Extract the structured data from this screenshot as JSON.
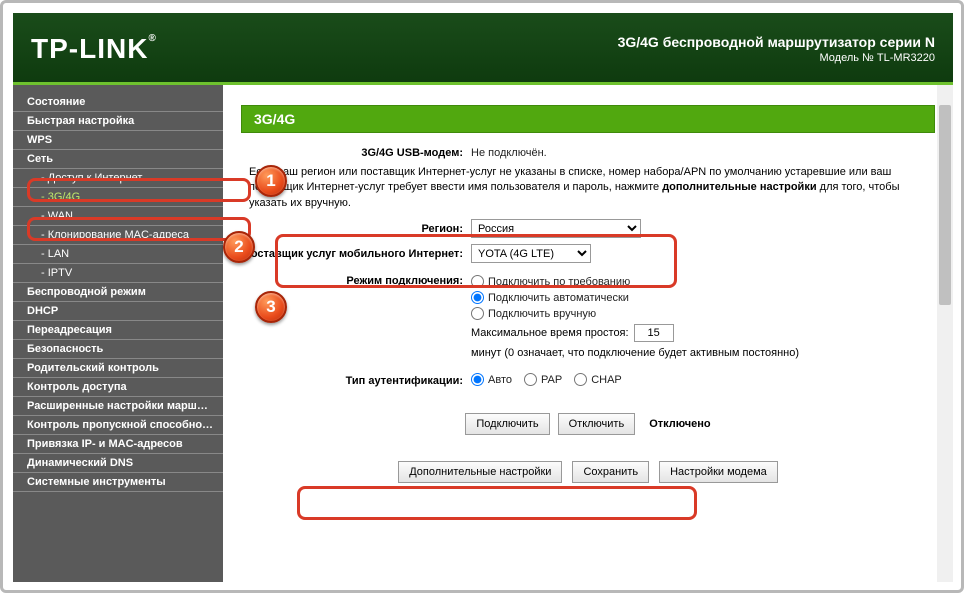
{
  "header": {
    "brand": "TP-LINK",
    "title": "3G/4G беспроводной маршрутизатор серии N",
    "model": "Модель № TL-MR3220"
  },
  "sidebar": {
    "items": [
      {
        "label": "Состояние",
        "sub": false
      },
      {
        "label": "Быстрая настройка",
        "sub": false
      },
      {
        "label": "WPS",
        "sub": false
      },
      {
        "label": "Сеть",
        "sub": false
      },
      {
        "label": "- Доступ к Интернет",
        "sub": true
      },
      {
        "label": "- 3G/4G",
        "sub": true,
        "active": true
      },
      {
        "label": "- WAN",
        "sub": true
      },
      {
        "label": "- Клонирование MAC-адреса",
        "sub": true
      },
      {
        "label": "- LAN",
        "sub": true
      },
      {
        "label": "- IPTV",
        "sub": true
      },
      {
        "label": "Беспроводной режим",
        "sub": false
      },
      {
        "label": "DHCP",
        "sub": false
      },
      {
        "label": "Переадресация",
        "sub": false
      },
      {
        "label": "Безопасность",
        "sub": false
      },
      {
        "label": "Родительский контроль",
        "sub": false
      },
      {
        "label": "Контроль доступа",
        "sub": false
      },
      {
        "label": "Расширенные настройки маршрутизации",
        "sub": false
      },
      {
        "label": "Контроль пропускной способности",
        "sub": false
      },
      {
        "label": "Привязка IP- и MAC-адресов",
        "sub": false
      },
      {
        "label": "Динамический DNS",
        "sub": false
      },
      {
        "label": "Системные инструменты",
        "sub": false
      }
    ]
  },
  "main": {
    "section_title": "3G/4G",
    "modem": {
      "label": "3G/4G USB-модем:",
      "value": "Не подключён."
    },
    "note_pre": "Если ваш регион или поставщик Интернет-услуг не указаны в списке, номер набора/APN по умолчанию устаревшие или ваш поставщик Интернет-услуг требует ввести имя пользователя и пароль, нажмите ",
    "note_link": "дополнительные настройки",
    "note_post": " для того, чтобы указать их вручную.",
    "location": {
      "label": "Регион:",
      "value": "Россия"
    },
    "isp": {
      "label": "Поставщик услуг мобильного Интернет:",
      "value": "YOTA (4G LTE)"
    },
    "conn_mode": {
      "label": "Режим подключения:",
      "options": [
        "Подключить по требованию",
        "Подключить автоматически",
        "Подключить вручную"
      ],
      "selected": 1
    },
    "max_idle": {
      "label_pre": "Максимальное время простоя:",
      "value": "15",
      "label_mid": "минут (0 означает, что подключение будет активным постоянно)"
    },
    "auth": {
      "label": "Тип аутентификации:",
      "options": [
        "Авто",
        "PAP",
        "CHAP"
      ],
      "selected": 0
    },
    "connect_btn": "Подключить",
    "disconnect_btn": "Отключить",
    "status": "Отключено",
    "btn_advanced": "Дополнительные настройки",
    "btn_save": "Сохранить",
    "btn_modem": "Настройки модема"
  },
  "markers": {
    "m1": "1",
    "m2": "2",
    "m3": "3"
  }
}
